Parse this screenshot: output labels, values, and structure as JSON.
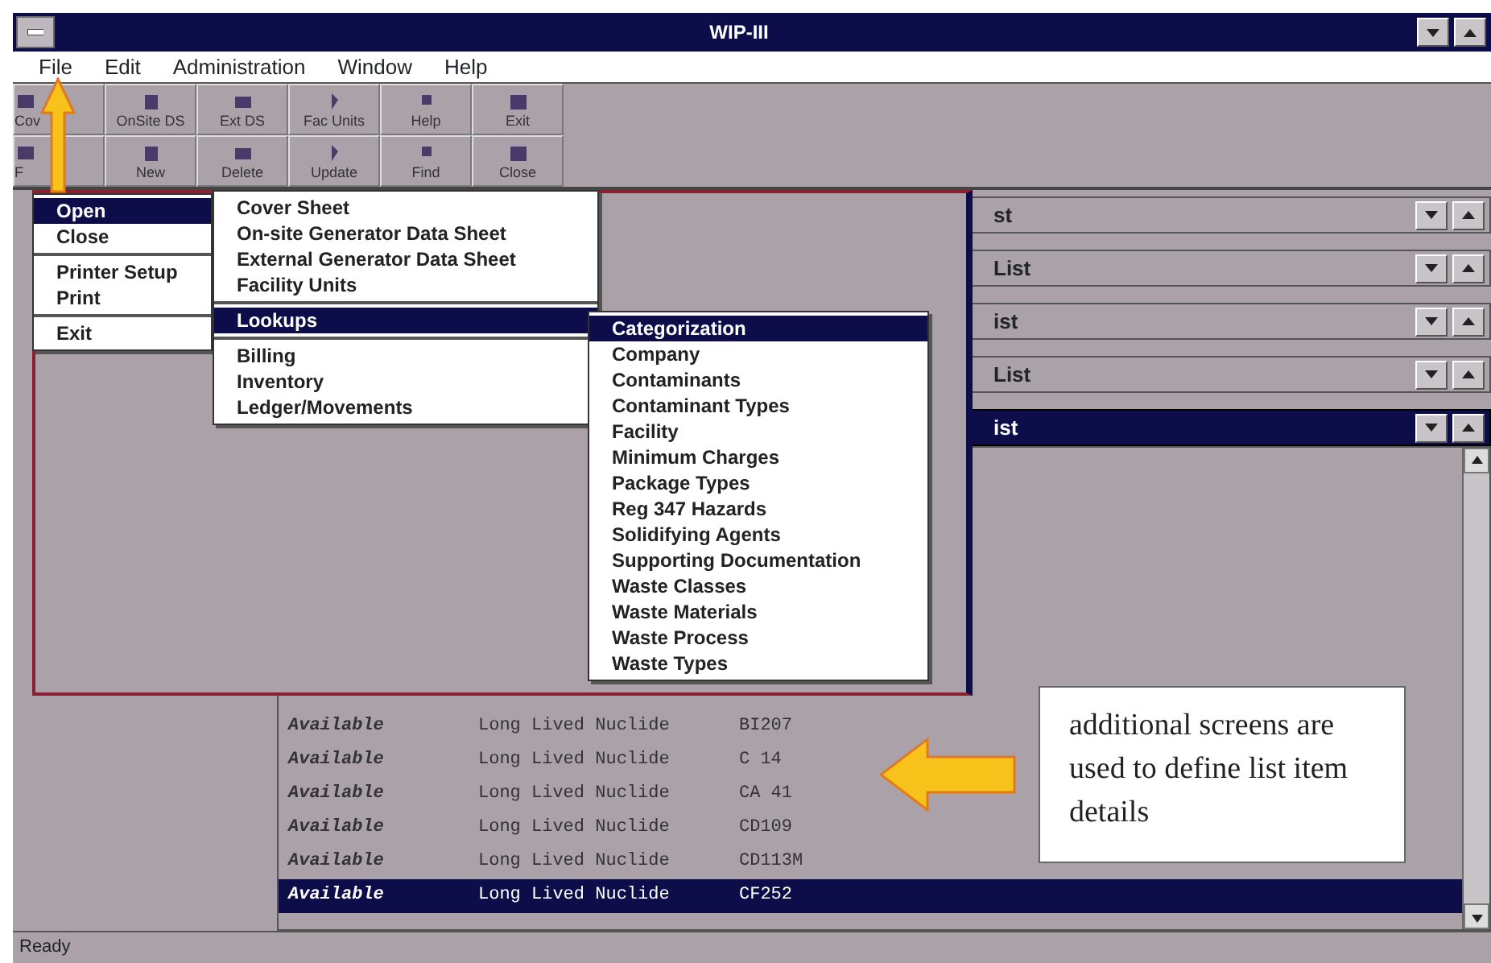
{
  "window": {
    "title": "WIP-III"
  },
  "menu_bar": [
    {
      "label": "File",
      "selected": false
    },
    {
      "label": "Edit",
      "selected": false
    },
    {
      "label": "Administration",
      "selected": false
    },
    {
      "label": "Window",
      "selected": false
    },
    {
      "label": "Help",
      "selected": false
    }
  ],
  "toolbar_rows": [
    [
      {
        "label": "Cov"
      },
      {
        "label": "OnSite DS"
      },
      {
        "label": "Ext DS"
      },
      {
        "label": "Fac Units"
      },
      {
        "label": "Help"
      },
      {
        "label": "Exit"
      }
    ],
    [
      {
        "label": "F"
      },
      {
        "label": "New"
      },
      {
        "label": "Delete"
      },
      {
        "label": "Update"
      },
      {
        "label": "Find"
      },
      {
        "label": "Close"
      }
    ]
  ],
  "file_menu": [
    {
      "kind": "item",
      "label": "Open",
      "selected": true
    },
    {
      "kind": "item",
      "label": "Close",
      "selected": false
    },
    {
      "kind": "separator"
    },
    {
      "kind": "item",
      "label": "Printer Setup",
      "selected": false
    },
    {
      "kind": "item",
      "label": "Print",
      "selected": false
    },
    {
      "kind": "separator"
    },
    {
      "kind": "item",
      "label": "Exit",
      "selected": false
    }
  ],
  "open_menu": [
    {
      "kind": "item",
      "label": "Cover Sheet",
      "selected": false
    },
    {
      "kind": "item",
      "label": "On-site Generator Data Sheet",
      "selected": false
    },
    {
      "kind": "item",
      "label": "External Generator Data Sheet",
      "selected": false
    },
    {
      "kind": "item",
      "label": "Facility Units",
      "selected": false
    },
    {
      "kind": "separator"
    },
    {
      "kind": "item",
      "label": "Lookups",
      "selected": true
    },
    {
      "kind": "separator"
    },
    {
      "kind": "item",
      "label": "Billing",
      "selected": false
    },
    {
      "kind": "item",
      "label": "Inventory",
      "selected": false
    },
    {
      "kind": "item",
      "label": "Ledger/Movements",
      "selected": false
    }
  ],
  "lookups_menu": [
    {
      "kind": "item",
      "label": "Categorization",
      "selected": true
    },
    {
      "kind": "item",
      "label": "Company",
      "selected": false
    },
    {
      "kind": "item",
      "label": "Contaminants",
      "selected": false
    },
    {
      "kind": "item",
      "label": "Contaminant Types",
      "selected": false
    },
    {
      "kind": "item",
      "label": "Facility",
      "selected": false
    },
    {
      "kind": "item",
      "label": "Minimum Charges",
      "selected": false
    },
    {
      "kind": "item",
      "label": "Package Types",
      "selected": false
    },
    {
      "kind": "item",
      "label": "Reg 347 Hazards",
      "selected": false
    },
    {
      "kind": "item",
      "label": "Solidifying Agents",
      "selected": false
    },
    {
      "kind": "item",
      "label": "Supporting Documentation",
      "selected": false
    },
    {
      "kind": "item",
      "label": "Waste Classes",
      "selected": false
    },
    {
      "kind": "item",
      "label": "Waste Materials",
      "selected": false
    },
    {
      "kind": "item",
      "label": "Waste Process",
      "selected": false
    },
    {
      "kind": "item",
      "label": "Waste Types",
      "selected": false
    }
  ],
  "child_windows": [
    {
      "title": "st",
      "active": false
    },
    {
      "title": "List",
      "active": false
    },
    {
      "title": "ist",
      "active": false
    },
    {
      "title": "List",
      "active": false
    },
    {
      "title": "ist",
      "active": true
    }
  ],
  "list_rows": [
    {
      "status": "Available",
      "type": "Long Lived Nuclide",
      "code": "BI207",
      "selected": false
    },
    {
      "status": "Available",
      "type": "Long Lived Nuclide",
      "code": "C  14",
      "selected": false
    },
    {
      "status": "Available",
      "type": "Long Lived Nuclide",
      "code": "CA 41",
      "selected": false
    },
    {
      "status": "Available",
      "type": "Long Lived Nuclide",
      "code": "CD109",
      "selected": false
    },
    {
      "status": "Available",
      "type": "Long Lived Nuclide",
      "code": "CD113M",
      "selected": false
    },
    {
      "status": "Available",
      "type": "Long Lived Nuclide",
      "code": "CF252",
      "selected": true
    }
  ],
  "callout": {
    "text": "additional screens are used to define list item details"
  },
  "status_bar": "Ready"
}
